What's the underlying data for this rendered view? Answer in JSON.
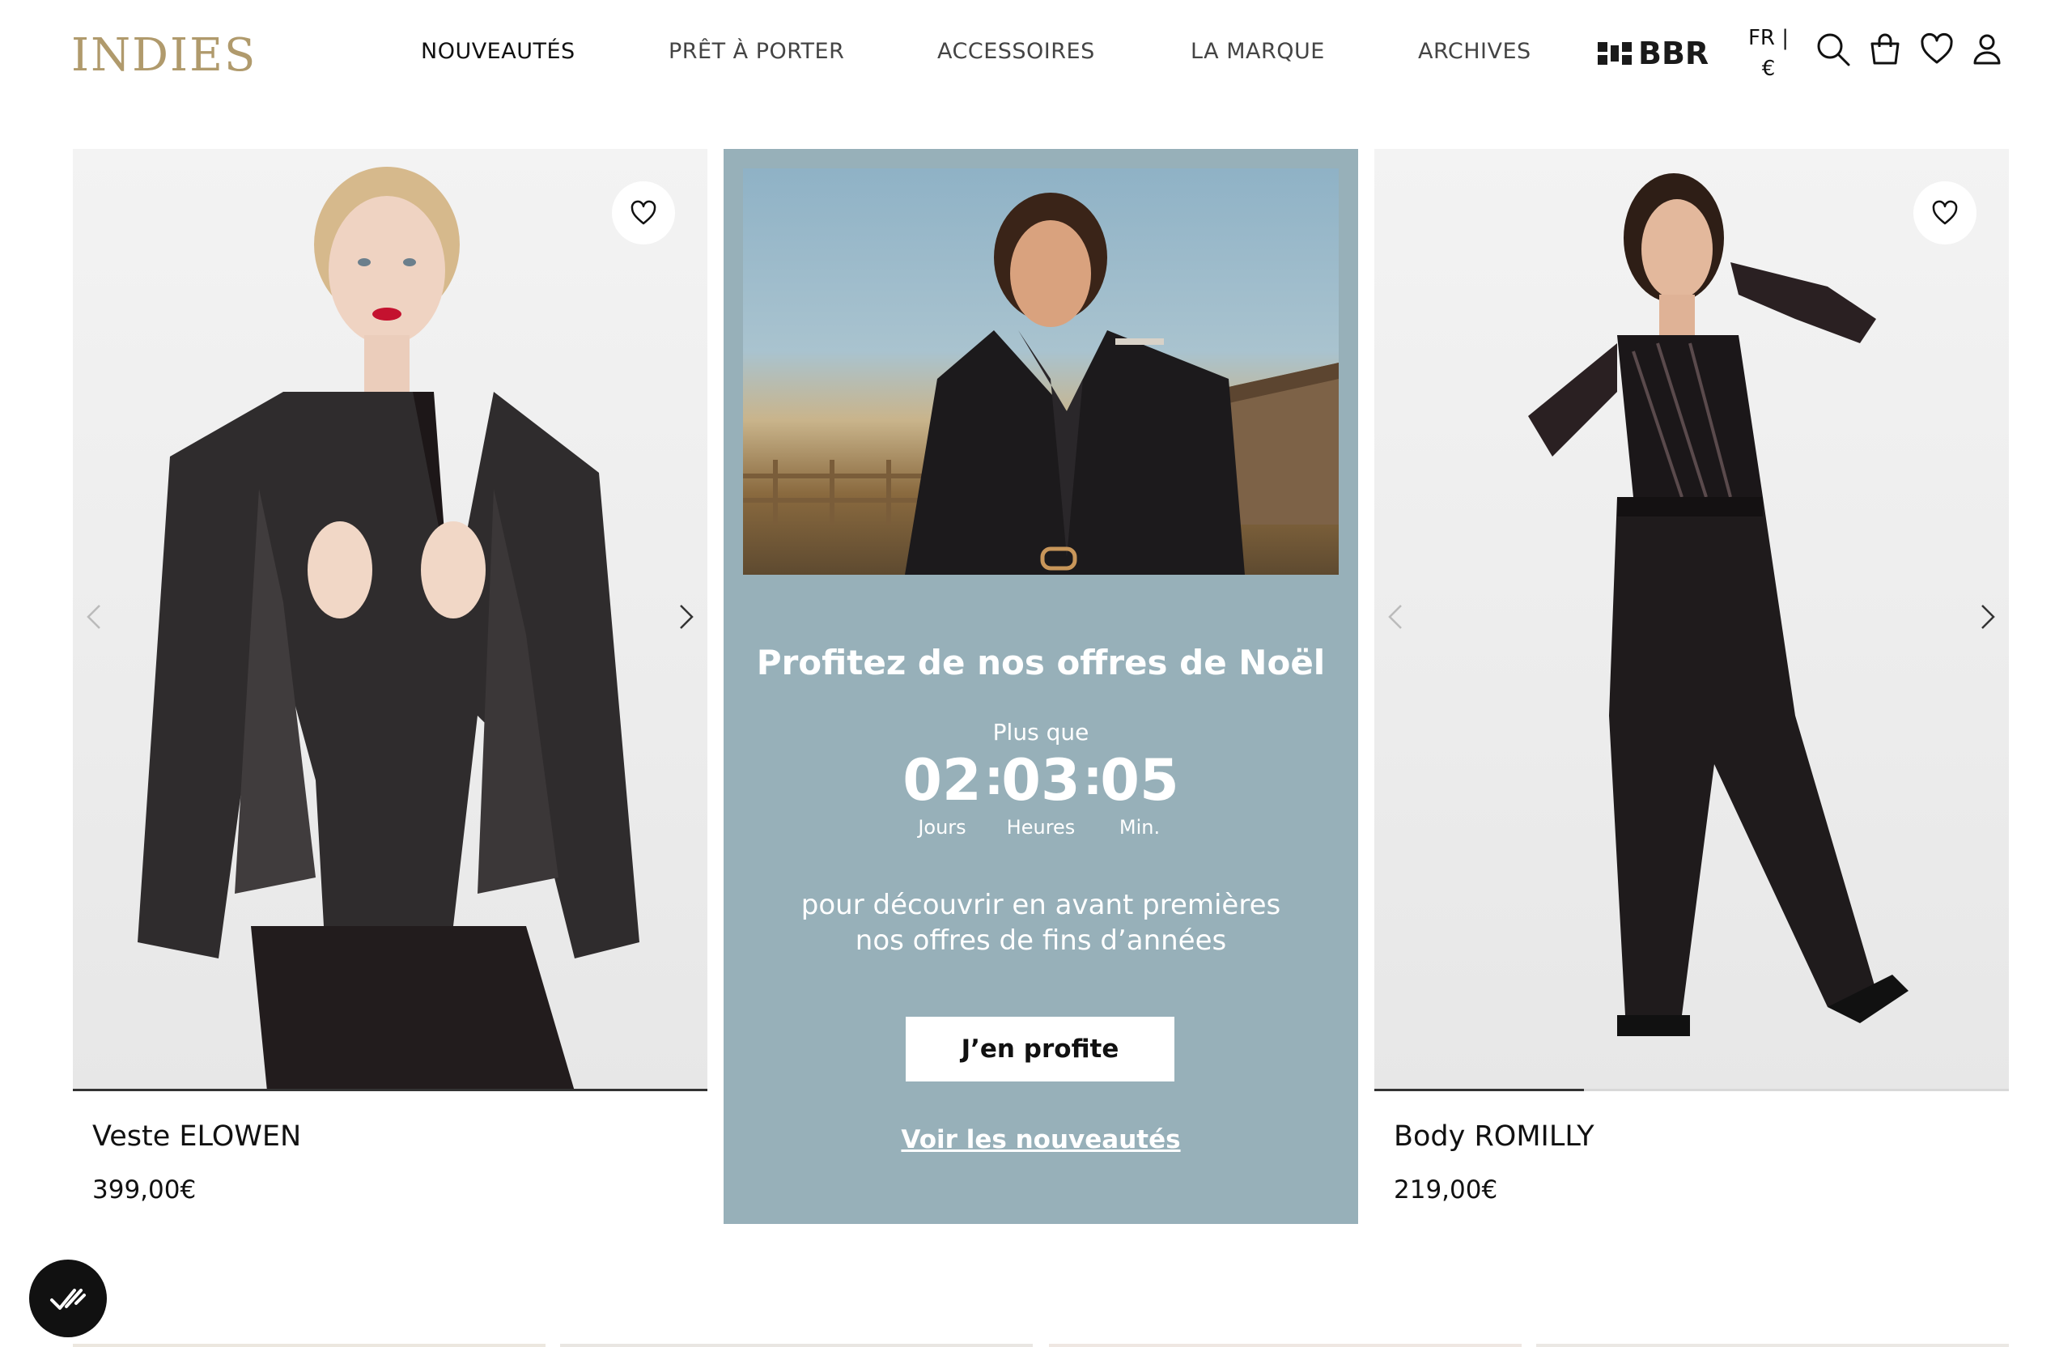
{
  "header": {
    "logo": "INDIES",
    "nav": [
      {
        "label": "NOUVEAUTÉS"
      },
      {
        "label": "PRÊT À PORTER"
      },
      {
        "label": "ACCESSOIRES"
      },
      {
        "label": "LA MARQUE"
      },
      {
        "label": "ARCHIVES"
      }
    ],
    "partner_logo": "BBR",
    "language": "FR |",
    "currency": "€",
    "icons": [
      "search-icon",
      "bag-icon",
      "heart-icon",
      "user-icon"
    ]
  },
  "products": [
    {
      "name": "Veste ELOWEN",
      "price": "399,00€",
      "image_progress": 1.0
    },
    {
      "name": "Body ROMILLY",
      "price": "219,00€",
      "image_progress": 0.33
    }
  ],
  "promo": {
    "title": "Profitez de nos offres de Noël",
    "subtitle": "Plus que",
    "countdown": [
      {
        "value": "02",
        "label": "Jours"
      },
      {
        "value": "03",
        "label": "Heures"
      },
      {
        "value": "05",
        "label": "Min."
      }
    ],
    "description_line1": "pour découvrir en avant premières",
    "description_line2": "nos offres de fins d’années",
    "cta": "J’en profite",
    "link": "Voir les nouveautés",
    "background_color": "#97b0b9"
  },
  "colors": {
    "logo": "#b09a6c",
    "text": "#111111",
    "badge": "#111111"
  }
}
